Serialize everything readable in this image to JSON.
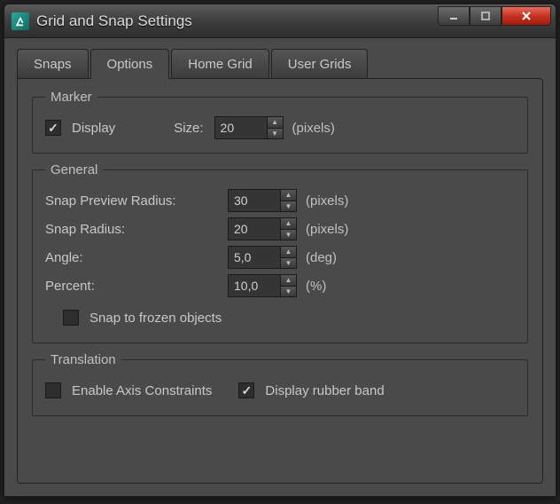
{
  "window": {
    "title": "Grid and Snap Settings"
  },
  "tabs": [
    {
      "label": "Snaps",
      "active": false
    },
    {
      "label": "Options",
      "active": true
    },
    {
      "label": "Home Grid",
      "active": false
    },
    {
      "label": "User Grids",
      "active": false
    }
  ],
  "marker": {
    "legend": "Marker",
    "display_label": "Display",
    "display_checked": true,
    "size_label": "Size:",
    "size_value": "20",
    "size_unit": "(pixels)"
  },
  "general": {
    "legend": "General",
    "snap_preview_label": "Snap Preview Radius:",
    "snap_preview_value": "30",
    "snap_preview_unit": "(pixels)",
    "snap_radius_label": "Snap Radius:",
    "snap_radius_value": "20",
    "snap_radius_unit": "(pixels)",
    "angle_label": "Angle:",
    "angle_value": "5,0",
    "angle_unit": "(deg)",
    "percent_label": "Percent:",
    "percent_value": "10,0",
    "percent_unit": "(%)",
    "frozen_label": "Snap to frozen objects",
    "frozen_checked": false
  },
  "translation": {
    "legend": "Translation",
    "axis_label": "Enable Axis Constraints",
    "axis_checked": false,
    "rubber_label": "Display rubber band",
    "rubber_checked": true
  }
}
